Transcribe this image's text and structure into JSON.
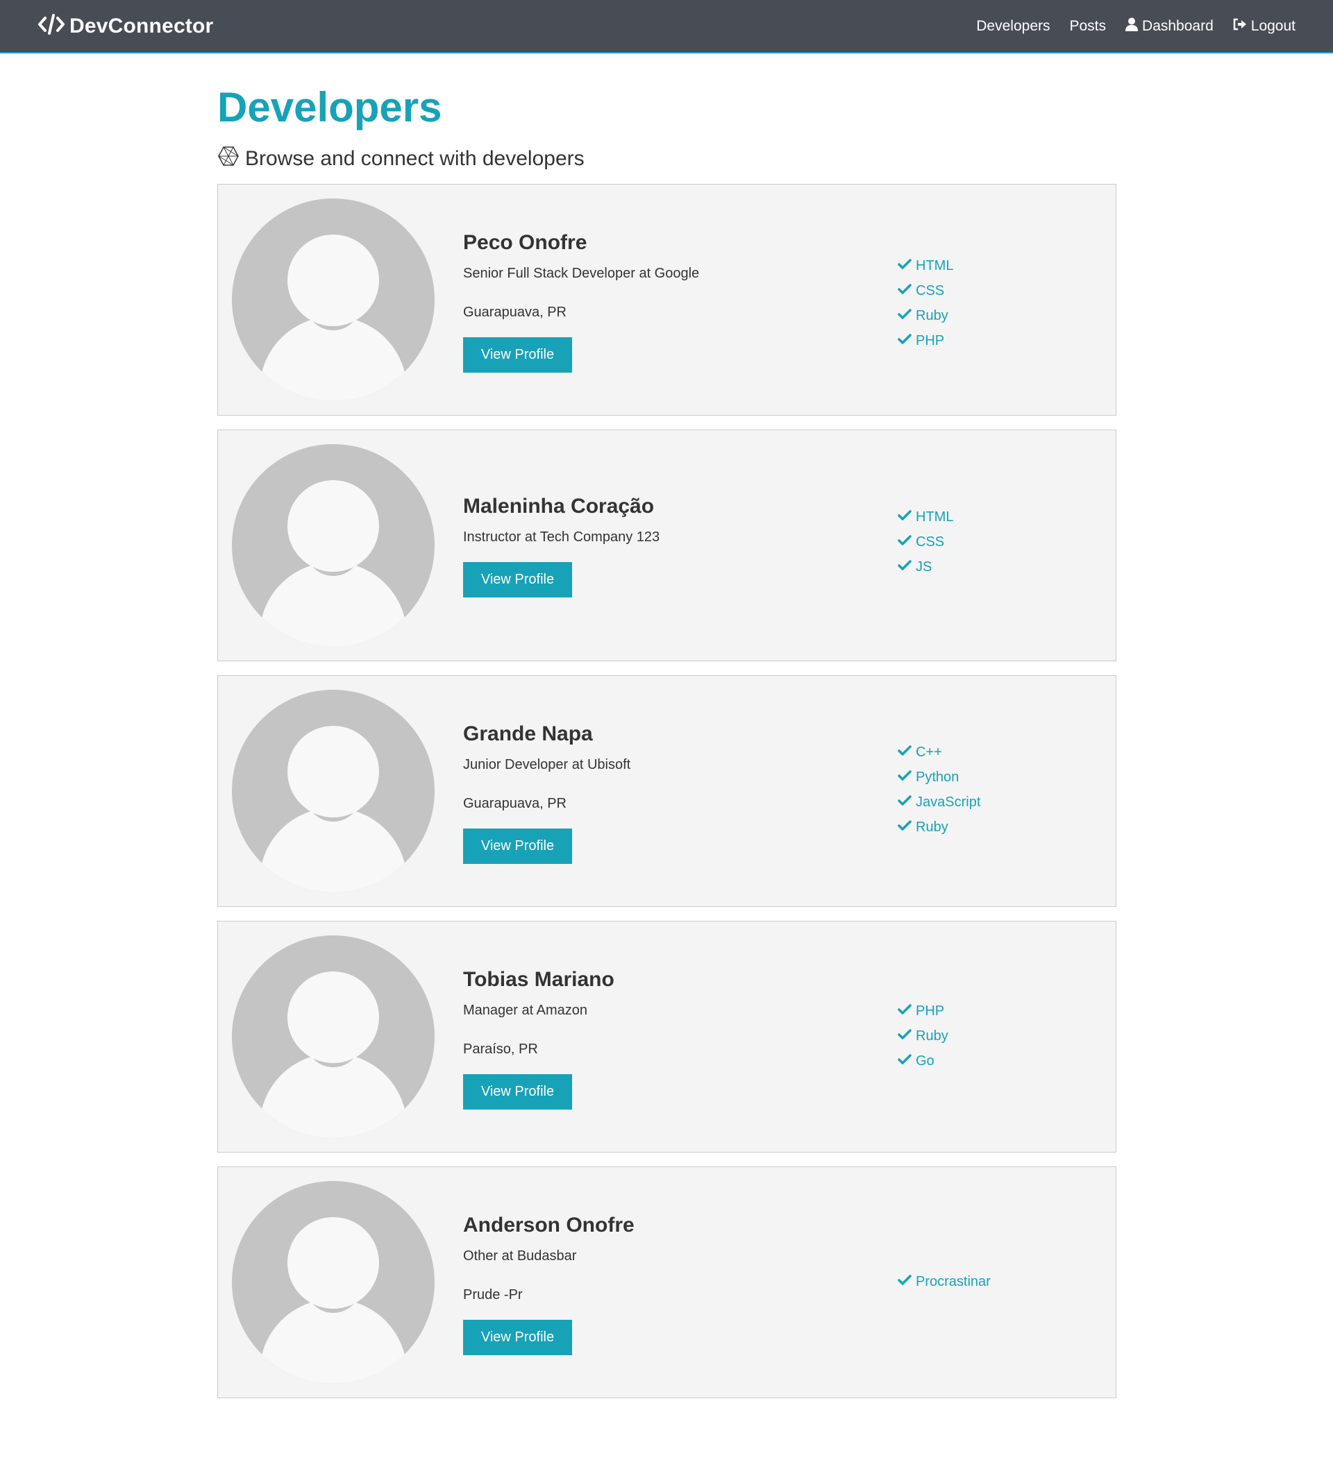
{
  "navbar": {
    "brand": "DevConnector",
    "links": [
      "Developers",
      "Posts",
      "Dashboard",
      "Logout"
    ]
  },
  "page": {
    "title": "Developers",
    "lead": "Browse and connect with developers"
  },
  "profiles": [
    {
      "name": "Peco Onofre",
      "status": "Senior Full Stack Developer at Google",
      "location": "Guarapuava, PR",
      "button": "View Profile",
      "skills": [
        "HTML",
        "CSS",
        "Ruby",
        "PHP"
      ]
    },
    {
      "name": "Maleninha Coração",
      "status": "Instructor at Tech Company 123",
      "location": "",
      "button": "View Profile",
      "skills": [
        "HTML",
        "CSS",
        "JS"
      ]
    },
    {
      "name": "Grande Napa",
      "status": "Junior Developer at Ubisoft",
      "location": "Guarapuava, PR",
      "button": "View Profile",
      "skills": [
        "C++",
        "Python",
        "JavaScript",
        "Ruby"
      ]
    },
    {
      "name": "Tobias Mariano",
      "status": "Manager at Amazon",
      "location": "Paraíso, PR",
      "button": "View Profile",
      "skills": [
        "PHP",
        "Ruby",
        "Go"
      ]
    },
    {
      "name": "Anderson Onofre",
      "status": "Other at Budasbar",
      "location": "Prude -Pr",
      "button": "View Profile",
      "skills": [
        "Procrastinar"
      ]
    }
  ],
  "colors": {
    "primary": "#17a2b8",
    "navbar": "#484c54",
    "card": "#f4f4f4",
    "avatar": "#c4c4c4"
  },
  "icons": {
    "brand": "code-icon",
    "dashboard": "user-icon",
    "logout": "sign-out-icon",
    "lead": "connectdevelop-icon",
    "skill": "check-icon"
  }
}
